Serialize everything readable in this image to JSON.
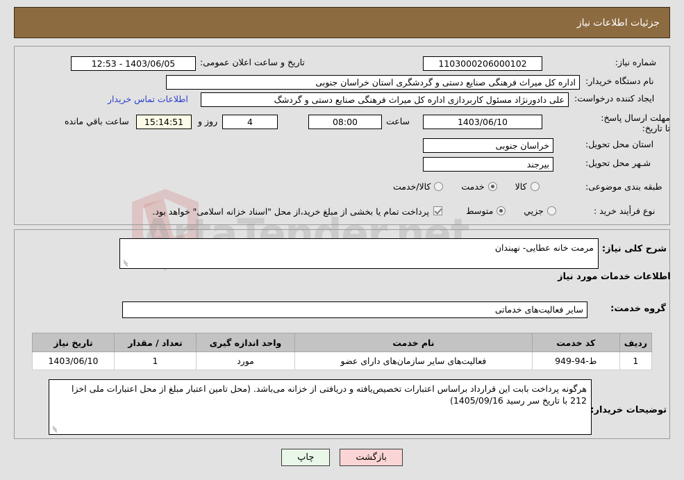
{
  "header": {
    "title": "جزئیات اطلاعات نیاز"
  },
  "colors": {
    "header_bar": "#8c6b40",
    "page_background": "#e2e2e2",
    "link": "#2b3fcf",
    "timer_background": "#fbfbe7",
    "table_header": "#c3c3c3",
    "print_button": "#e9f7e9",
    "back_button": "#fbd5d5"
  },
  "top_form": {
    "need_number_label": "شماره نیاز:",
    "need_number_value": "1103000206000102",
    "announce_datetime_label": "تاریخ و ساعت اعلان عمومی:",
    "announce_datetime_value": "1403/06/05 - 12:53",
    "buyer_org_label": "نام دستگاه خریدار:",
    "buyer_org_value": "اداره کل میراث فرهنگی  صنایع دستی و گردشگری استان خراسان جنوبی",
    "creator_label": "ایجاد کننده درخواست:",
    "creator_value": "علی دادورنژاد مسئول کاربردازی اداره کل میراث فرهنگی  صنایع دستی و گردشگ",
    "contact_link": "اطلاعات تماس خریدار",
    "deadline_label": "مهلت ارسال پاسخ: تا تاریخ:",
    "deadline_date": "1403/06/10",
    "hour_label": "ساعت",
    "deadline_time": "08:00",
    "remaining_days": "4",
    "days_and_label": "روز و",
    "remaining_time": "15:14:51",
    "remaining_suffix": "ساعت باقي مانده",
    "province_label": "استان محل تحویل:",
    "province_value": "خراسان جنوبی",
    "city_label": "شـهر محل تحویل:",
    "city_value": "بیرجند",
    "category_label": "طبقه بندی موضوعی:",
    "category_options": [
      {
        "label": "کالا",
        "selected": false
      },
      {
        "label": "خدمت",
        "selected": true
      },
      {
        "label": "کالا/خدمت",
        "selected": false
      }
    ],
    "process_label": "نوع فرأیند خرید :",
    "process_options": [
      {
        "label": "جزیي",
        "selected": false
      },
      {
        "label": "متوسط",
        "selected": true
      }
    ],
    "treasury_checkbox_checked": true,
    "treasury_note": "پرداخت تمام یا بخشی از مبلغ خرید،از محل \"اسناد خزانه اسلامی\" خواهد بود."
  },
  "middle": {
    "need_summary_label": "شرح کلی نیاز:",
    "need_summary_value": "مرمت خانه عطایی- نهبندان",
    "services_section_title": "اطلاعات خدمات مورد نیاز",
    "service_group_label": "گروه خدمت:",
    "service_group_value": "سایر فعالیت‌های خدماتی",
    "buyer_notes_label": "توضیحات خریدار:",
    "buyer_notes_value": "هرگونه پرداخت بابت این قرارداد براساس اعتبارات تخصیص‌یافته و دریافتی از خزانه می‌باشد. (محل تامین اعتبار مبلغ از محل اعتبارات ملی اخزا 212 با تاریخ سر رسید 1405/09/16)"
  },
  "table": {
    "columns": [
      "ردیف",
      "کد خدمت",
      "نام خدمت",
      "واحد اندازه گیری",
      "تعداد / مقدار",
      "تاریخ نیاز"
    ],
    "rows": [
      {
        "index": "1",
        "service_code": "ط-94-949",
        "service_name": "فعالیت‌های سایر سازمان‌های دارای عضو",
        "unit": "مورد",
        "quantity": "1",
        "need_date": "1403/06/10"
      }
    ]
  },
  "buttons": {
    "print": "چاپ",
    "back": "بازگشت"
  },
  "watermark": {
    "text": "ArtaTender.net"
  }
}
